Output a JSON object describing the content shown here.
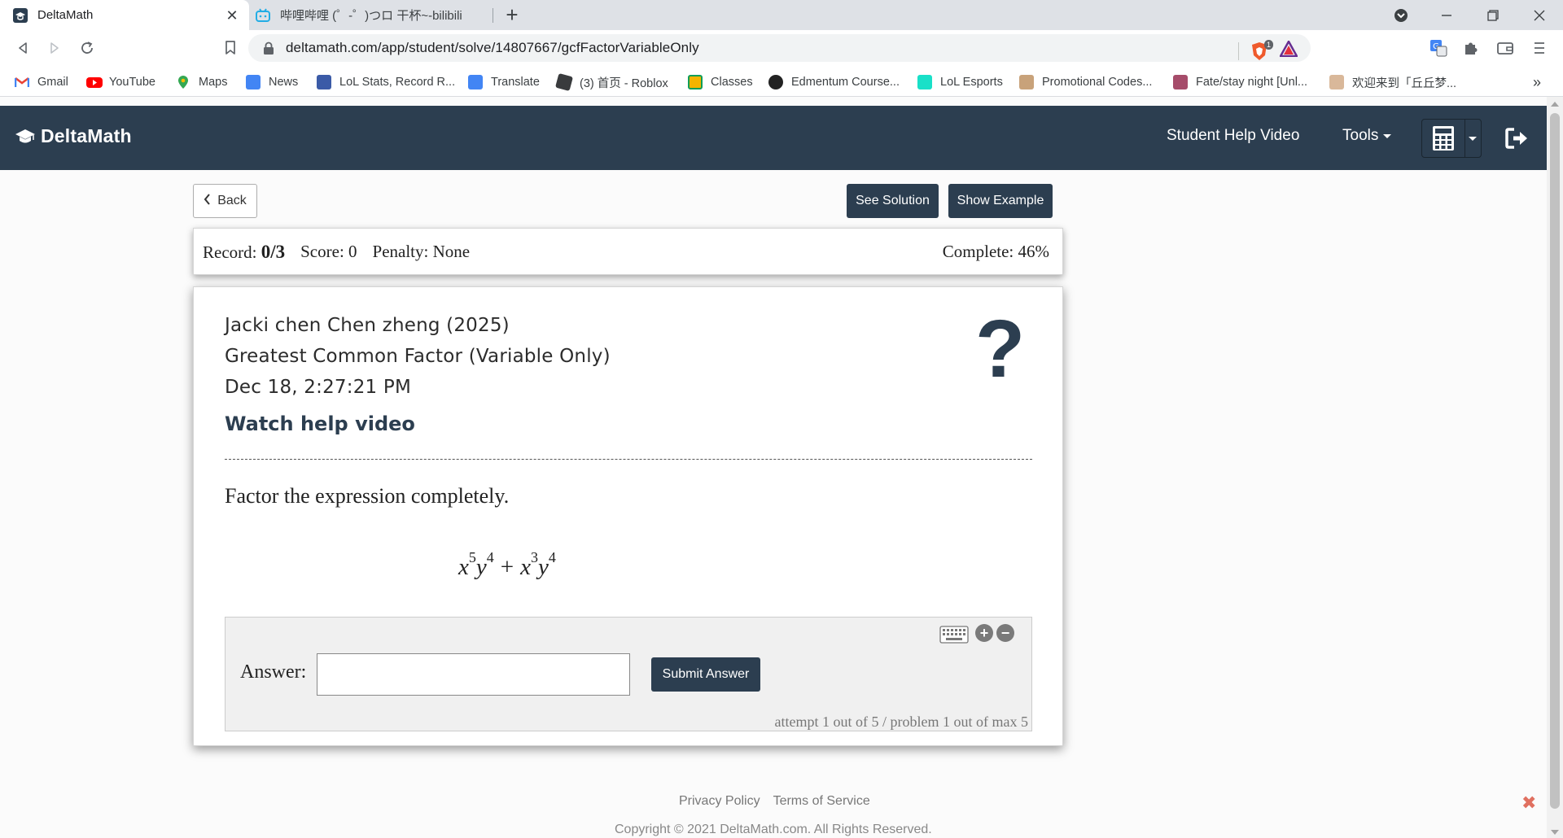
{
  "browser": {
    "tabs": [
      {
        "title": "DeltaMath",
        "active": true
      },
      {
        "title": "哔哩哔哩 (゜-゜)つロ 干杯~-bilibili",
        "active": false
      }
    ],
    "url": "deltamath.com/app/student/solve/14807667/gcfFactorVariableOnly",
    "extension_badge": "1",
    "bookmarks": [
      "Gmail",
      "YouTube",
      "Maps",
      "News",
      "LoL Stats, Record R...",
      "Translate",
      "(3) 首页 - Roblox",
      "Classes",
      "Edmentum Course...",
      "LoL Esports",
      "Promotional Codes...",
      "Fate/stay night [Unl...",
      "欢迎来到「丘丘梦..."
    ],
    "more_bookmarks": "»"
  },
  "navbar": {
    "brand": "DeltaMath",
    "help_video": "Student Help Video",
    "tools": "Tools"
  },
  "actions": {
    "back": "Back",
    "see_solution": "See Solution",
    "show_example": "Show Example"
  },
  "record": {
    "record_label": "Record:",
    "record_value": "0/3",
    "score": "Score: 0",
    "penalty": "Penalty: None",
    "complete": "Complete: 46%"
  },
  "problem": {
    "student": "Jacki chen Chen zheng (2025)",
    "topic": "Greatest Common Factor (Variable Only)",
    "timestamp": "Dec 18, 2:27:21 PM",
    "help_link": "Watch help video",
    "question_mark": "?",
    "prompt": "Factor the expression completely.",
    "expression": {
      "t1_base1": "x",
      "t1_exp1": "5",
      "t1_base2": "y",
      "t1_exp2": "4",
      "op": "+",
      "t2_base1": "x",
      "t2_exp1": "3",
      "t2_base2": "y",
      "t2_exp2": "4"
    }
  },
  "answer": {
    "label": "Answer:",
    "value": "",
    "submit": "Submit Answer",
    "attempt": "attempt 1 out of 5 / problem 1 out of max 5"
  },
  "footer": {
    "privacy": "Privacy Policy",
    "terms": "Terms of Service",
    "copyright": "Copyright © 2021 DeltaMath.com. All Rights Reserved.",
    "close": "✖"
  },
  "colors": {
    "brand_dark": "#2c3e50",
    "page_bg": "#fbfbfb"
  }
}
